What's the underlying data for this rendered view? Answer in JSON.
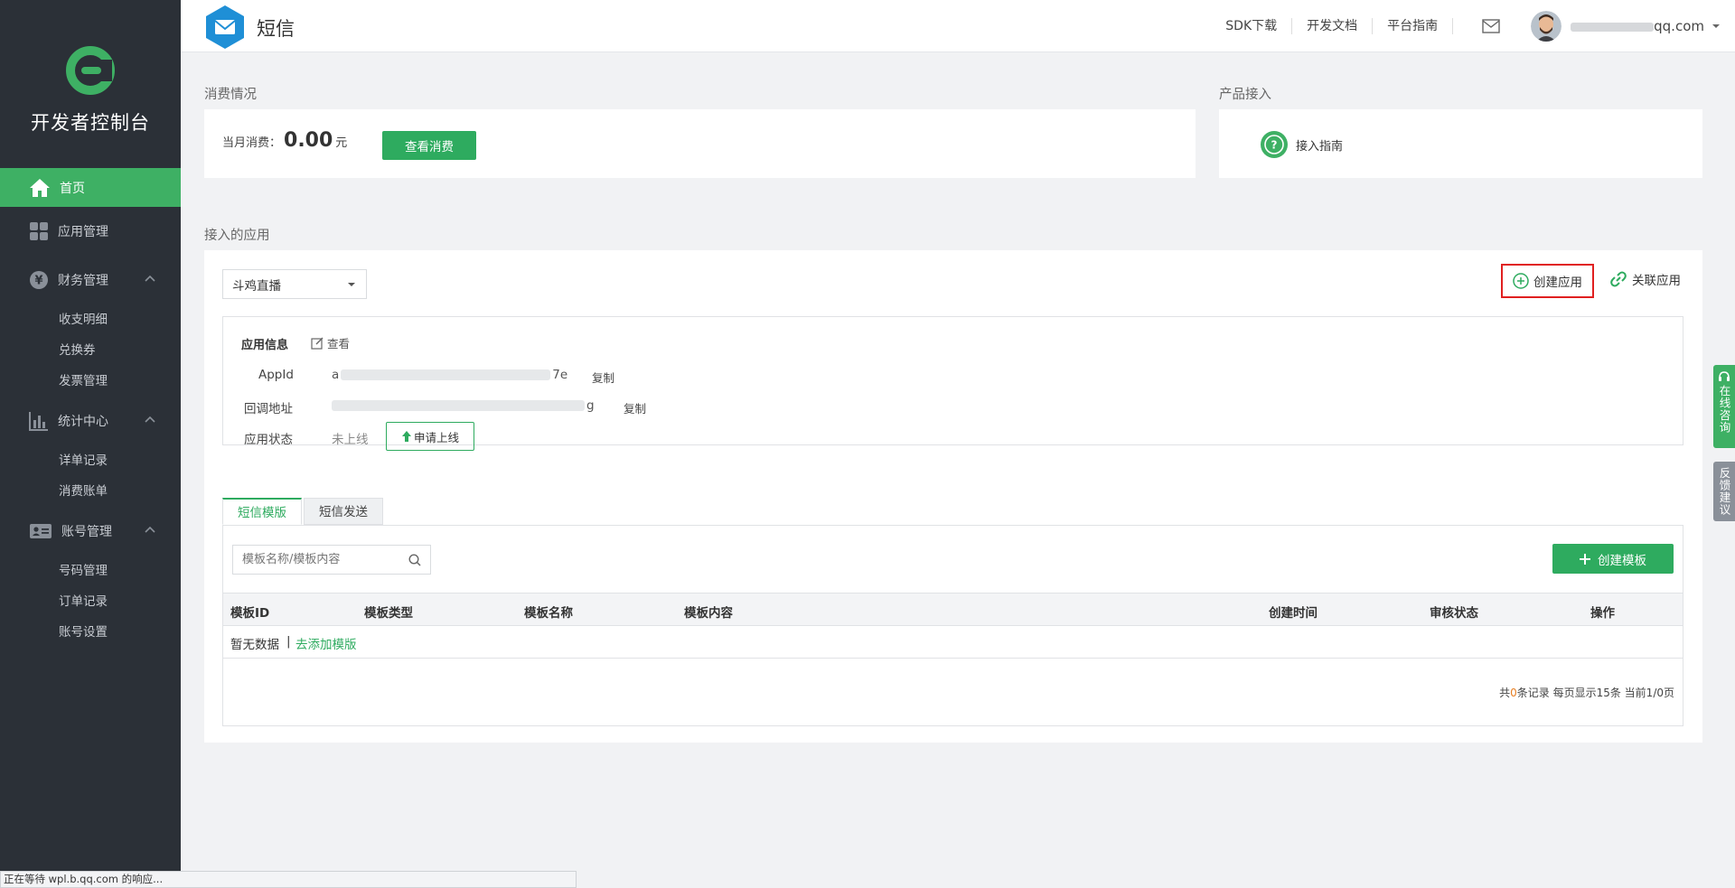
{
  "sidebar": {
    "title": "开发者控制台",
    "home": "首页",
    "app_mgmt": "应用管理",
    "finance": {
      "label": "财务管理",
      "items": [
        "收支明细",
        "兑换券",
        "发票管理"
      ]
    },
    "stats": {
      "label": "统计中心",
      "items": [
        "详单记录",
        "消费账单"
      ]
    },
    "account": {
      "label": "账号管理",
      "items": [
        "号码管理",
        "订单记录",
        "账号设置"
      ]
    }
  },
  "topbar": {
    "product": "短信",
    "links": [
      "SDK下载",
      "开发文档",
      "平台指南"
    ],
    "email_suffix": "qq.com"
  },
  "consumption": {
    "section_title": "消费情况",
    "label": "当月消费：",
    "amount": "0.00",
    "unit": "元",
    "button": "查看消费"
  },
  "access": {
    "section_title": "产品接入",
    "guide": "接入指南"
  },
  "apps": {
    "section_title": "接入的应用",
    "selected_app": "斗鸡直播",
    "create_app": "创建应用",
    "link_app": "关联应用",
    "info_title": "应用信息",
    "view": "查看",
    "appid_label": "AppId",
    "appid_head": "a",
    "appid_tail": "7e",
    "callback_label": "回调地址",
    "callback_tail": "g",
    "copy": "复制",
    "status_label": "应用状态",
    "status_value": "未上线",
    "apply_online": "申请上线"
  },
  "templates": {
    "tabs": [
      "短信模版",
      "短信发送"
    ],
    "search_placeholder": "模板名称/模板内容",
    "create_button": "创建模板",
    "columns": [
      "模板ID",
      "模板类型",
      "模板名称",
      "模板内容",
      "创建时间",
      "审核状态",
      "操作"
    ],
    "empty_text": "暂无数据",
    "add_link": "去添加模版",
    "pager": {
      "prefix": "共",
      "count": "0",
      "suffix": "条记录 每页显示15条 当前1/0页"
    }
  },
  "side_tabs": {
    "consult": "在线咨询",
    "feedback": "反馈建议"
  },
  "statusbar": "正在等待 wpl.b.qq.com 的响应...",
  "colors": {
    "accent": "#2eab5f",
    "sidebar_bg": "#2b3037",
    "highlight_border": "#e02020"
  }
}
